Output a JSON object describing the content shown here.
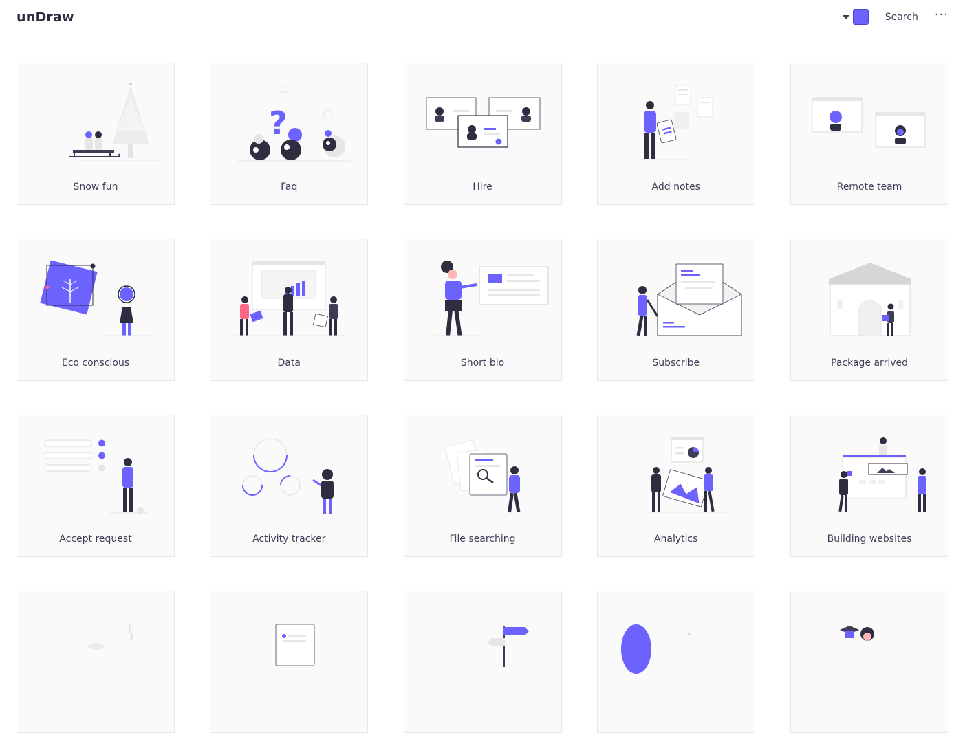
{
  "header": {
    "logo": "unDraw",
    "search_label": "Search",
    "more_label": "···",
    "accent_color": "#6c63ff"
  },
  "illustrations": [
    {
      "label": "Snow fun"
    },
    {
      "label": "Faq"
    },
    {
      "label": "Hire"
    },
    {
      "label": "Add notes"
    },
    {
      "label": "Remote team"
    },
    {
      "label": "Eco conscious"
    },
    {
      "label": "Data"
    },
    {
      "label": "Short bio"
    },
    {
      "label": "Subscribe"
    },
    {
      "label": "Package arrived"
    },
    {
      "label": "Accept request"
    },
    {
      "label": "Activity tracker"
    },
    {
      "label": "File searching"
    },
    {
      "label": "Analytics"
    },
    {
      "label": "Building websites"
    },
    {
      "label": ""
    },
    {
      "label": ""
    },
    {
      "label": ""
    },
    {
      "label": ""
    },
    {
      "label": ""
    }
  ]
}
